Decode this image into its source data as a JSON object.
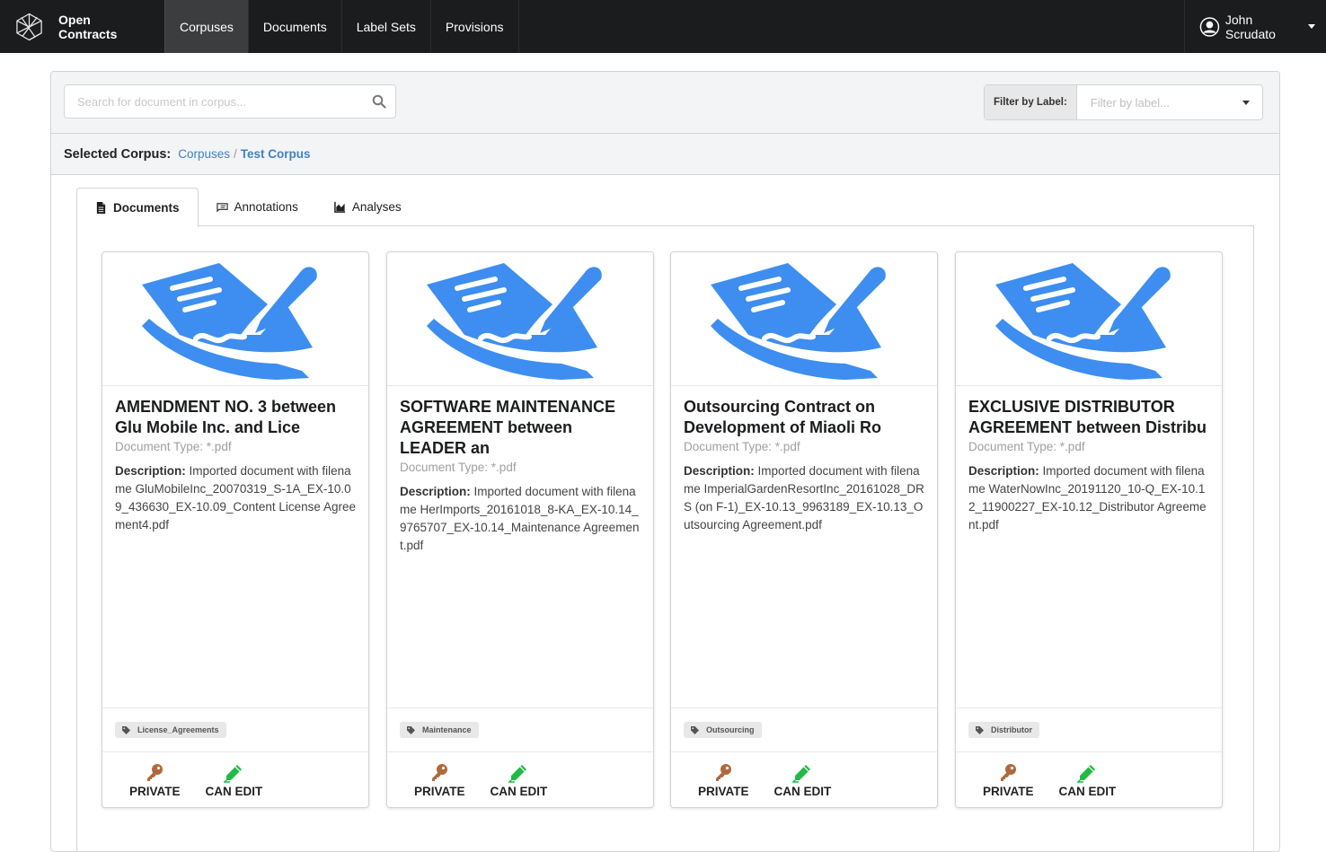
{
  "navbar": {
    "brand": "Open Contracts",
    "items": [
      {
        "label": "Corpuses",
        "active": true
      },
      {
        "label": "Documents",
        "active": false
      },
      {
        "label": "Label Sets",
        "active": false
      },
      {
        "label": "Provisions",
        "active": false
      }
    ],
    "user": "John Scrudato"
  },
  "toolbar": {
    "search_placeholder": "Search for document in corpus...",
    "filter_label": "Filter by Label:",
    "filter_placeholder": "Filter by label..."
  },
  "breadcrumb": {
    "prefix": "Selected Corpus:",
    "root": "Corpuses",
    "separator": "/",
    "current": "Test Corpus"
  },
  "tabs": [
    {
      "label": "Documents",
      "active": true,
      "icon": "file-icon"
    },
    {
      "label": "Annotations",
      "active": false,
      "icon": "annotation-icon"
    },
    {
      "label": "Analyses",
      "active": false,
      "icon": "area-chart-icon"
    }
  ],
  "cards": [
    {
      "title": "AMENDMENT NO. 3 between Glu Mobile Inc. and Lice",
      "doc_type": "Document Type: *.pdf",
      "desc_label": "Description:",
      "description": " Imported document with filename GluMobileInc_20070319_S-1A_EX-10.09_436630_EX-10.09_Content License Agreement4.pdf",
      "label": "License_Agreements",
      "private_label": "PRIVATE",
      "edit_label": "CAN EDIT"
    },
    {
      "title": "SOFTWARE MAINTENANCE AGREEMENT between LEADER an",
      "doc_type": "Document Type: *.pdf",
      "desc_label": "Description:",
      "description": " Imported document with filename HerImports_20161018_8-KA_EX-10.14_9765707_EX-10.14_Maintenance Agreement.pdf",
      "label": "Maintenance",
      "private_label": "PRIVATE",
      "edit_label": "CAN EDIT"
    },
    {
      "title": "Outsourcing Contract on Development of Miaoli Ro",
      "doc_type": "Document Type: *.pdf",
      "desc_label": "Description:",
      "description": " Imported document with filename ImperialGardenResortInc_20161028_DRS (on F-1)_EX-10.13_9963189_EX-10.13_Outsourcing Agreement.pdf",
      "label": "Outsourcing",
      "private_label": "PRIVATE",
      "edit_label": "CAN EDIT"
    },
    {
      "title": "EXCLUSIVE DISTRIBUTOR AGREEMENT between Distribu",
      "doc_type": "Document Type: *.pdf",
      "desc_label": "Description:",
      "description": " Imported document with filename WaterNowInc_20191120_10-Q_EX-10.12_11900227_EX-10.12_Distributor Agreement.pdf",
      "label": "Distributor",
      "private_label": "PRIVATE",
      "edit_label": "CAN EDIT"
    }
  ],
  "colors": {
    "navbar_bg": "#1b1c1d",
    "link": "#4183c4",
    "doc_icon_blue": "#3d8ef0",
    "key_icon": "#b0693a",
    "pencil_icon": "#21ba45"
  }
}
